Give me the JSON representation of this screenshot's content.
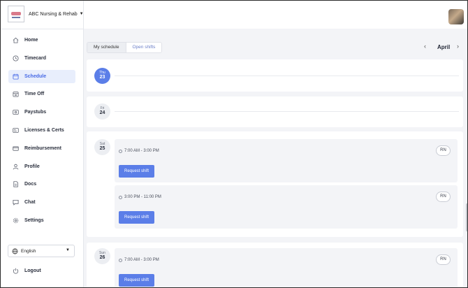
{
  "org": {
    "name": "ABC Nursing & Rehab"
  },
  "sidebar": {
    "items": [
      {
        "label": "Home",
        "icon": "home-icon"
      },
      {
        "label": "Timecard",
        "icon": "clock-icon"
      },
      {
        "label": "Schedule",
        "icon": "calendar-icon",
        "active": true
      },
      {
        "label": "Time Off",
        "icon": "calendar-off-icon"
      },
      {
        "label": "Paystubs",
        "icon": "dollar-icon"
      },
      {
        "label": "Licenses & Certs",
        "icon": "id-card-icon"
      },
      {
        "label": "Reimbursement",
        "icon": "receipt-icon"
      },
      {
        "label": "Profile",
        "icon": "user-icon"
      },
      {
        "label": "Docs",
        "icon": "document-icon"
      },
      {
        "label": "Chat",
        "icon": "chat-icon"
      },
      {
        "label": "Settings",
        "icon": "gear-icon"
      }
    ],
    "language": "English",
    "logout": "Logout"
  },
  "tabs": {
    "my_schedule": "My schedule",
    "open_shifts": "Open shifts"
  },
  "month": "April",
  "days": [
    {
      "dow": "Thu",
      "num": "23"
    },
    {
      "dow": "Fri",
      "num": "24"
    },
    {
      "dow": "Sat",
      "num": "25",
      "shifts": [
        {
          "time": "7:00 AM - 3:00 PM",
          "role": "RN",
          "button": "Request shift"
        },
        {
          "time": "3:00 PM - 11:00 PM",
          "role": "RN",
          "button": "Request shift"
        }
      ]
    },
    {
      "dow": "Sun",
      "num": "26",
      "shifts": [
        {
          "time": "7:00 AM - 3:00 PM",
          "role": "RN",
          "button": "Request shift"
        }
      ]
    }
  ],
  "colors": {
    "accent": "#5b7ee8",
    "active_bg": "#e8eefc",
    "background": "#f3f4f7"
  }
}
